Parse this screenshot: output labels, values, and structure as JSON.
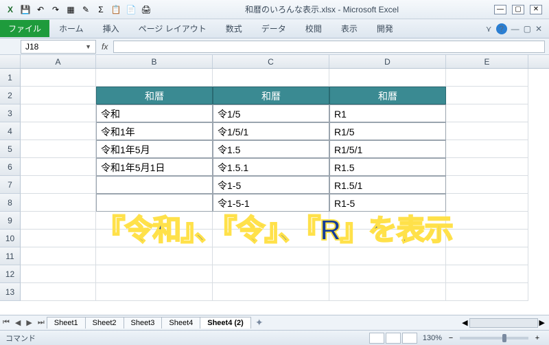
{
  "title": "和暦のいろんな表示.xlsx - Microsoft Excel",
  "ribbon": {
    "file": "ファイル",
    "tabs": [
      "ホーム",
      "挿入",
      "ページ レイアウト",
      "数式",
      "データ",
      "校閲",
      "表示",
      "開発"
    ]
  },
  "namebox": "J18",
  "columns": [
    "A",
    "B",
    "C",
    "D",
    "E"
  ],
  "table": {
    "header": [
      "和暦",
      "和暦",
      "和暦"
    ],
    "rows": [
      [
        "令和",
        "令1/5",
        "R1"
      ],
      [
        "令和1年",
        "令1/5/1",
        "R1/5"
      ],
      [
        "令和1年5月",
        "令1.5",
        "R1/5/1"
      ],
      [
        "令和1年5月1日",
        "令1.5.1",
        "R1.5"
      ],
      [
        "",
        "令1-5",
        "R1.5/1"
      ],
      [
        "",
        "令1-5-1",
        "R1-5"
      ]
    ]
  },
  "overlay": "『令和』、『令』、『R』を表示",
  "sheets": [
    "Sheet1",
    "Sheet2",
    "Sheet3",
    "Sheet4",
    "Sheet4 (2)"
  ],
  "active_sheet": 4,
  "status": {
    "mode": "コマンド",
    "zoom": "130%"
  },
  "icons": {
    "excel": "X",
    "save": "💾",
    "undo": "↶",
    "redo": "↷",
    "min": "—",
    "max": "▢",
    "close": "✕"
  }
}
